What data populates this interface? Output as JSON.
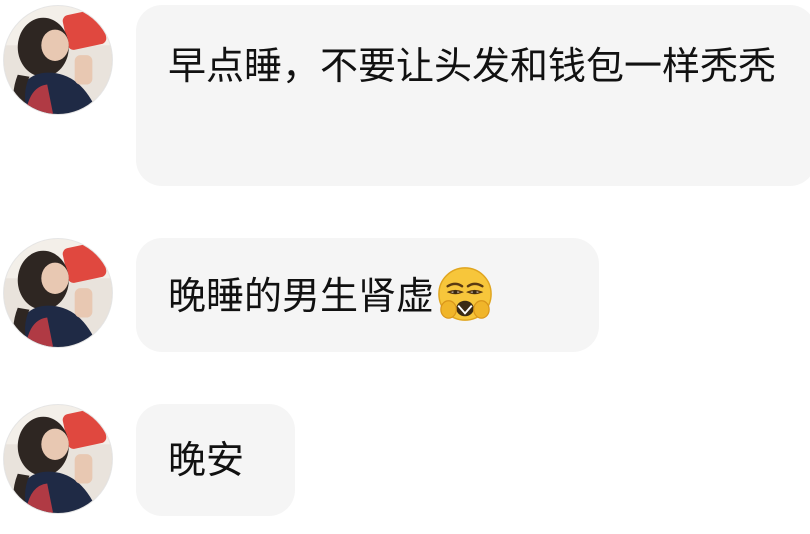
{
  "messages": [
    {
      "text": "早点睡，不要让头发和钱包一样秃秃",
      "avatar_icon": "user-avatar-icon"
    },
    {
      "text": "晚睡的男生肾虚",
      "emoji_icon": "exhausted-face-emoji-icon",
      "avatar_icon": "user-avatar-icon"
    },
    {
      "text": "晚安",
      "avatar_icon": "user-avatar-icon"
    }
  ],
  "colors": {
    "bubble_background": "#f5f5f5",
    "text": "#111111",
    "background": "#ffffff"
  }
}
